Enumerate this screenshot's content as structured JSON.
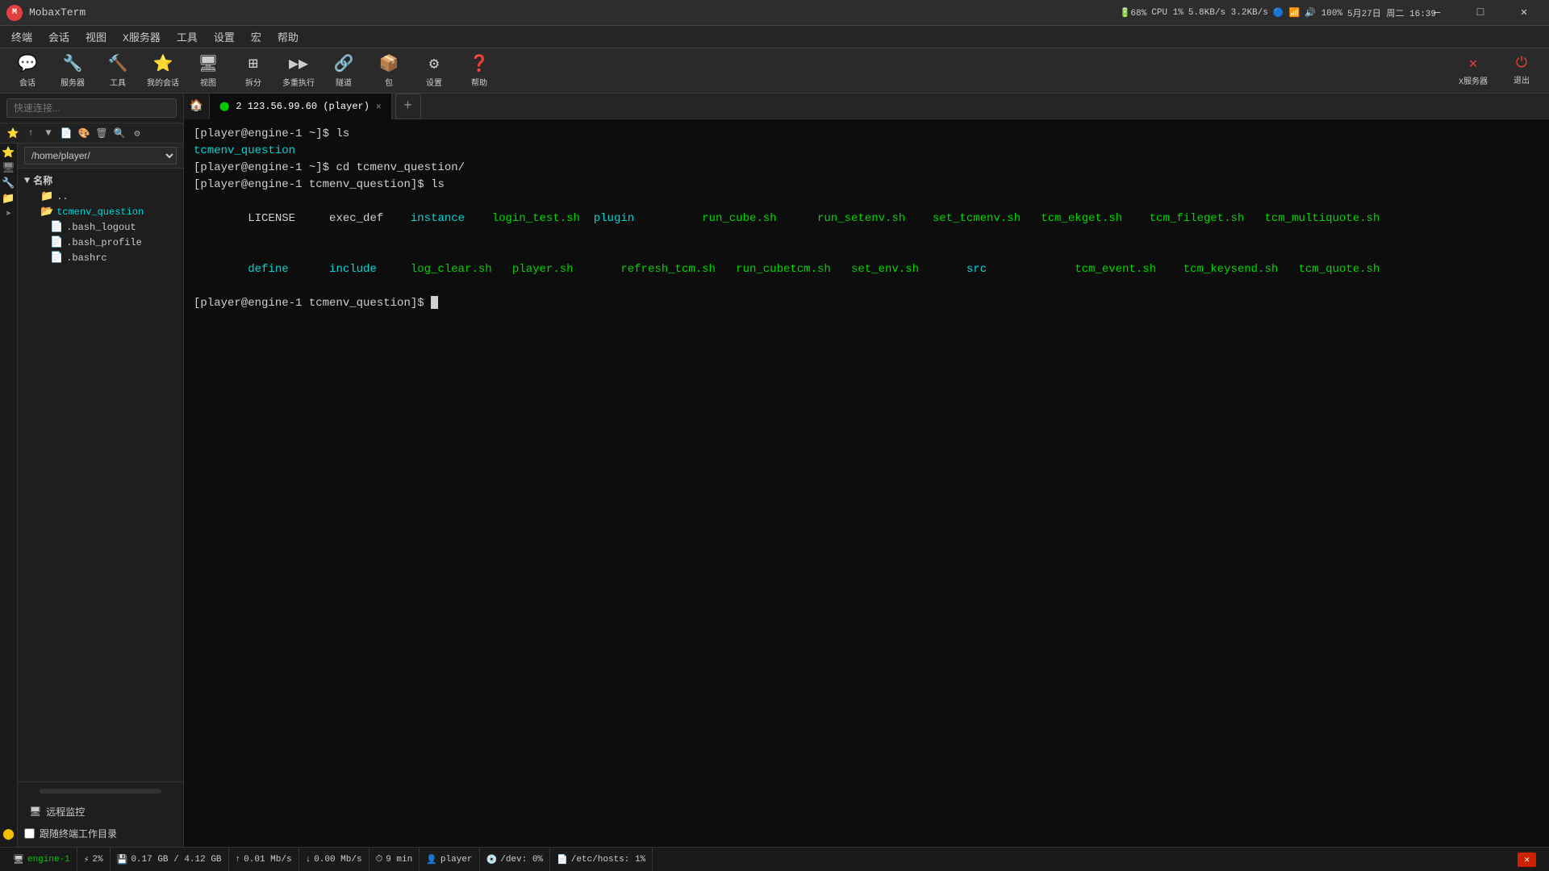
{
  "titlebar": {
    "logo_text": "M",
    "title": "MobaxTerm",
    "btn_minimize": "—",
    "btn_maximize": "□",
    "btn_close": "✕"
  },
  "systray": {
    "time": "5月27日 周二 16:39",
    "battery": "68%",
    "cpu": "1%",
    "network": "5.8KB/s 3.2KB/s",
    "volume": "100%"
  },
  "menubar": {
    "items": [
      "终端",
      "会话",
      "视图",
      "X服务器",
      "工具",
      "设置",
      "宏",
      "帮助"
    ]
  },
  "toolbar": {
    "buttons": [
      {
        "id": "huihua",
        "label": "会话",
        "icon": "💬"
      },
      {
        "id": "fuwuqi",
        "label": "服务器",
        "icon": "🔧"
      },
      {
        "id": "gongju",
        "label": "工具",
        "icon": "🔨"
      },
      {
        "id": "wodehuihua",
        "label": "我的会话",
        "icon": "⭐"
      },
      {
        "id": "shipu",
        "label": "视图",
        "icon": "🖥"
      },
      {
        "id": "chafen",
        "label": "拆分",
        "icon": "⊞"
      },
      {
        "id": "duochong",
        "label": "多重执行",
        "icon": "▶"
      },
      {
        "id": "suida",
        "label": "隧道",
        "icon": "🔗"
      },
      {
        "id": "bao",
        "label": "包",
        "icon": "📦"
      },
      {
        "id": "shezhi",
        "label": "设置",
        "icon": "⚙"
      },
      {
        "id": "bangzhu",
        "label": "帮助",
        "icon": "❓"
      }
    ],
    "right_buttons": [
      {
        "id": "x-server",
        "label": "X服务器",
        "icon": "✕"
      },
      {
        "id": "tuichu",
        "label": "退出",
        "icon": "⏻"
      }
    ]
  },
  "sidebar": {
    "search_placeholder": "快速连接...",
    "path": "/home/player/",
    "tree_header": "名称",
    "tree_items": [
      {
        "label": "..",
        "type": "folder",
        "indent": 1
      },
      {
        "label": "tcmenv_question",
        "type": "folder",
        "indent": 1,
        "active": true
      },
      {
        "label": ".bash_logout",
        "type": "file",
        "indent": 2
      },
      {
        "label": ".bash_profile",
        "type": "file",
        "indent": 2
      },
      {
        "label": ".bashrc",
        "type": "file",
        "indent": 2
      }
    ],
    "monitor_label": "远程监控",
    "follow_dir_label": "跟随终端工作目录"
  },
  "tabs": {
    "home_icon": "🏠",
    "items": [
      {
        "id": "tab1",
        "label": "2  123.56.99.60 (player)",
        "active": true
      },
      {
        "id": "tab2",
        "label": "",
        "active": false
      }
    ],
    "add_label": "+"
  },
  "terminal": {
    "lines": [
      {
        "type": "prompt_cmd",
        "prompt": "[player@engine-1 ~]$ ",
        "cmd": "ls"
      },
      {
        "type": "dir_output",
        "content": "tcmenv_question"
      },
      {
        "type": "prompt_cmd",
        "prompt": "[player@engine-1 ~]$ ",
        "cmd": "cd tcmenv_question/"
      },
      {
        "type": "prompt_cmd",
        "prompt": "[player@engine-1 tcmenv_question]$ ",
        "cmd": "ls"
      },
      {
        "type": "ls_output",
        "cols": [
          [
            "LICENSE",
            "exec_def",
            "instance",
            "login_test.sh",
            "plugin",
            "run_cube.sh",
            "run_setenv.sh",
            "set_tcmenv.sh",
            "tcm_ekget.sh",
            "tcm_fileget.sh",
            "tcm_multiquote.sh"
          ],
          [
            "define",
            "include",
            "log_clear.sh",
            "player.sh",
            "refresh_tcm.sh",
            "run_cubetcm.sh",
            "set_env.sh",
            "src",
            "tcm_event.sh",
            "tcm_keysend.sh",
            "tcm_quote.sh"
          ]
        ]
      },
      {
        "type": "prompt_cursor",
        "prompt": "[player@engine-1 tcmenv_question]$ "
      }
    ],
    "ls_row1": {
      "c1": "LICENSE",
      "c2": "exec_def",
      "c3": "instance",
      "c4": "login_test.sh",
      "c5": "plugin",
      "c6": "run_cube.sh",
      "c7": "run_setenv.sh",
      "c8": "set_tcmenv.sh",
      "c9": "tcm_ekget.sh",
      "c10": "tcm_fileget.sh",
      "c11": "tcm_multiquote.sh"
    },
    "ls_row2": {
      "c1": "define",
      "c2": "include",
      "c3": "log_clear.sh",
      "c4": "player.sh",
      "c5": "refresh_tcm.sh",
      "c6": "run_cubetcm.sh",
      "c7": "set_env.sh",
      "c8": "src",
      "c9": "tcm_event.sh",
      "c10": "tcm_keysend.sh",
      "c11": "tcm_quote.sh"
    }
  },
  "statusbar": {
    "items": [
      {
        "icon": "🖥",
        "label": "engine-1"
      },
      {
        "icon": "⚡",
        "label": "2%"
      },
      {
        "icon": "💾",
        "label": "0.17 GB / 4.12 GB"
      },
      {
        "icon": "↑",
        "label": "0.01 Mb/s"
      },
      {
        "icon": "↓",
        "label": "0.00 Mb/s"
      },
      {
        "icon": "⏱",
        "label": "9 min"
      },
      {
        "icon": "👤",
        "label": "player"
      },
      {
        "icon": "💿",
        "label": "/dev: 0%"
      },
      {
        "icon": "📄",
        "label": "/etc/hosts: 1%"
      }
    ],
    "close_label": "✕"
  }
}
